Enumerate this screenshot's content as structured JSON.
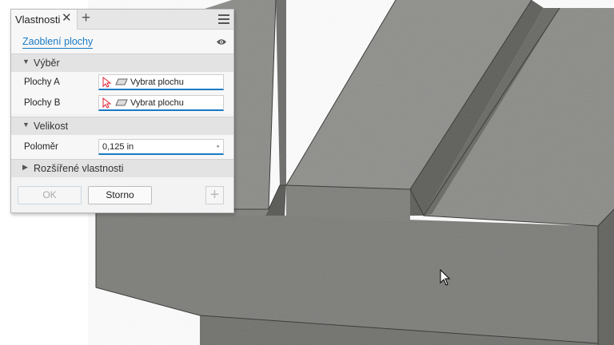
{
  "panel": {
    "tab_title": "Vlastnosti",
    "command_name": "Zaoblení plochy",
    "sections": {
      "selection": "Výběr",
      "size": "Velikost",
      "advanced": "Rozšířené vlastnosti"
    },
    "fields": {
      "faces_a_label": "Plochy A",
      "faces_a_value": "Vybrat plochu",
      "faces_b_label": "Plochy B",
      "faces_b_value": "Vybrat plochu",
      "radius_label": "Poloměr",
      "radius_value": "0,125 in"
    },
    "buttons": {
      "ok": "OK",
      "cancel": "Storno"
    }
  },
  "colors": {
    "accent": "#1a7ac4",
    "model_gray": "#7b7b78"
  }
}
